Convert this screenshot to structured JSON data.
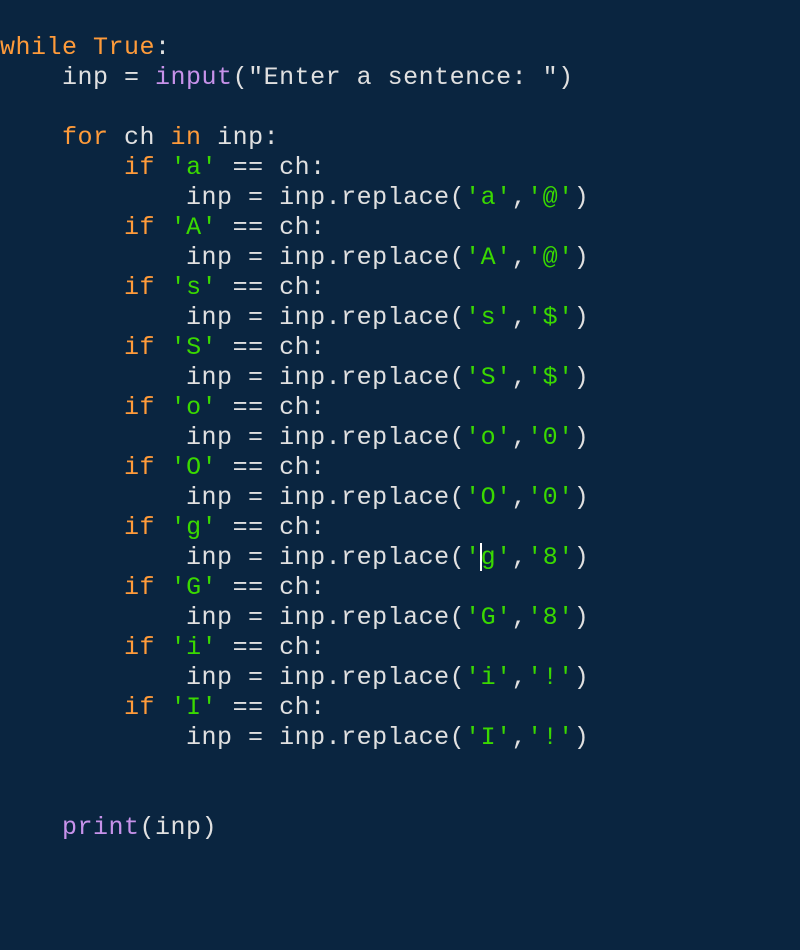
{
  "code": {
    "line1_while": "while",
    "line1_true": "True",
    "line1_colon": ":",
    "line2_var": "inp",
    "line2_eq": " = ",
    "line2_fn": "input",
    "line2_str": "\"Enter a sentence: \"",
    "line4_for": "for",
    "line4_ch": " ch ",
    "line4_in": "in",
    "line4_inp": " inp",
    "line4_colon": ":",
    "if_kw": "if",
    "eq_op": " == ",
    "ch_var": "ch",
    "colon": ":",
    "inp_var": "inp",
    "assign": " = ",
    "replace_prefix_inp": "inp",
    "replace_dot": ".",
    "replace_attr": "replace",
    "open": "(",
    "close": ")",
    "comma": ",",
    "branches": [
      {
        "cmp": "'a'",
        "from": "'a'",
        "to": "'@'"
      },
      {
        "cmp": "'A'",
        "from": "'A'",
        "to": "'@'"
      },
      {
        "cmp": "'s'",
        "from": "'s'",
        "to": "'$'"
      },
      {
        "cmp": "'S'",
        "from": "'S'",
        "to": "'$'"
      },
      {
        "cmp": "'o'",
        "from": "'o'",
        "to": "'0'"
      },
      {
        "cmp": "'O'",
        "from": "'O'",
        "to": "'0'"
      },
      {
        "cmp": "'g'",
        "from": "'g'",
        "to": "'8'",
        "caret_in_from": true
      },
      {
        "cmp": "'G'",
        "from": "'G'",
        "to": "'8'"
      },
      {
        "cmp": "'i'",
        "from": "'i'",
        "to": "'!'"
      },
      {
        "cmp": "'I'",
        "from": "'I'",
        "to": "'!'"
      }
    ],
    "print_fn": "print",
    "print_arg": "inp"
  },
  "colors": {
    "background": "#0a2540",
    "keyword": "#ff9b3a",
    "string": "#3ad900",
    "function": "#c792ea",
    "default": "#e0e0e0"
  }
}
